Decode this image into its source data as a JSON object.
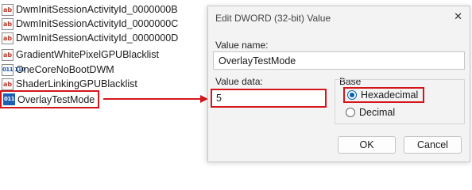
{
  "registry_list": {
    "entries": [
      {
        "name": "DwmInitSessionActivityId_0000000B",
        "type": "string-value-icon"
      },
      {
        "name": "DwmInitSessionActivityId_0000000C",
        "type": "string-value-icon"
      },
      {
        "name": "DwmInitSessionActivityId_0000000D",
        "type": "string-value-icon"
      },
      {
        "name": "GradientWhitePixelGPUBlacklist",
        "type": "string-value-icon"
      },
      {
        "name": "OneCoreNoBootDWM",
        "type": "dword-value-icon"
      },
      {
        "name": "ShaderLinkingGPUBlacklist",
        "type": "string-value-icon"
      },
      {
        "name": "OverlayTestMode",
        "type": "dword-value-icon"
      }
    ],
    "icon_glyphs": {
      "string": "ab",
      "dword": "011 110"
    }
  },
  "dialog": {
    "title": "Edit DWORD (32-bit) Value",
    "close_glyph": "✕",
    "value_name_label": "Value name:",
    "value_name": "OverlayTestMode",
    "value_data_label": "Value data:",
    "value_data": "5",
    "base_label": "Base",
    "base_options": [
      "Hexadecimal",
      "Decimal"
    ],
    "base_selected": "Hexadecimal",
    "ok_label": "OK",
    "cancel_label": "Cancel"
  },
  "colors": {
    "highlight_red": "#d4161b",
    "radio_blue": "#0063b1",
    "dialog_bg": "#f3f3f3"
  }
}
